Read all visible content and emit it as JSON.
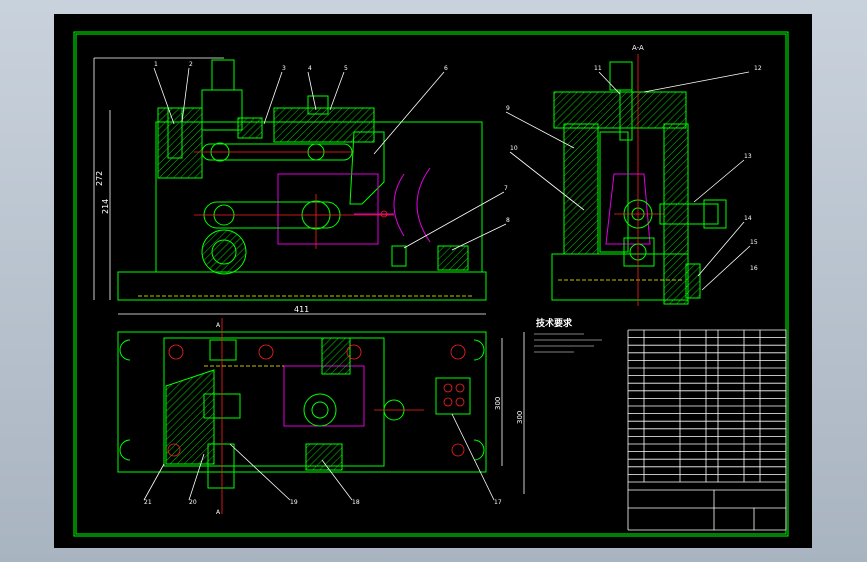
{
  "drawing": {
    "section_label": "A-A",
    "dimensions": {
      "overall_height": "272",
      "height_2": "214",
      "base_width": "411",
      "right_dim_1": "300",
      "right_dim_2": "300"
    },
    "balloon_numbers_front": [
      "1",
      "2",
      "3",
      "4",
      "5",
      "6",
      "7",
      "8"
    ],
    "balloon_numbers_section": [
      "9",
      "10",
      "11",
      "12",
      "13",
      "14",
      "15",
      "16"
    ],
    "balloon_numbers_top": [
      "17",
      "18",
      "19",
      "20",
      "21"
    ],
    "section_markers": [
      "A",
      "A"
    ],
    "tech_requirements_title": "技术要求",
    "colors": {
      "outline": "#00ff00",
      "text": "#ffffff",
      "center": "#ff2020",
      "part": "#e000e0",
      "hidden": "#ffff00",
      "background": "#000000"
    }
  }
}
